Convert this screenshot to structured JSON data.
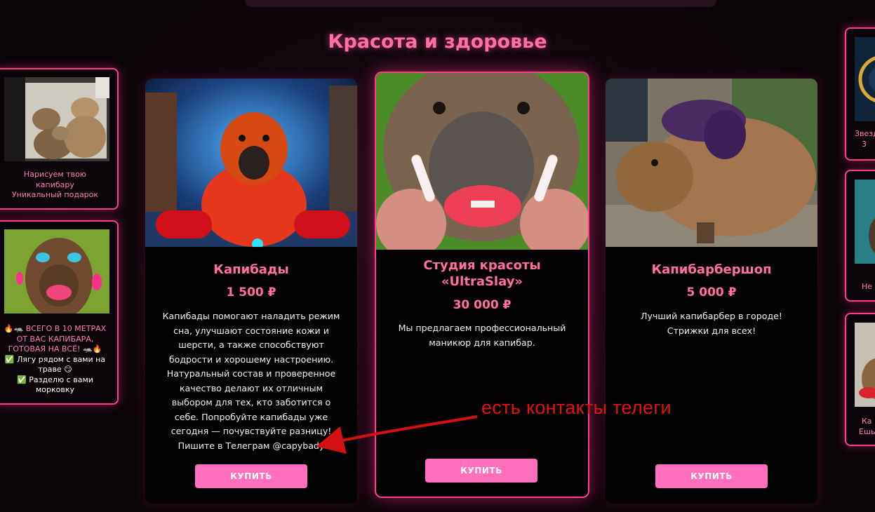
{
  "section": {
    "title": "Красота и здоровье"
  },
  "cards": [
    {
      "title": "Капибады",
      "price": "1 500 ₽",
      "description": "Капибады помогают наладить режим сна, улучшают состояние кожи и шерсти, а также способствуют бодрости и хорошему настроению. Натуральный состав и проверенное качество делают их отличным выбором для тех, кто заботится о себе. Попробуйте капибады уже сегодня — почувствуйте разницу! Пишите в Телеграм @capybady",
      "button": "КУПИТЬ"
    },
    {
      "title": "Студия красоты «UltraSlay»",
      "price": "30 000 ₽",
      "description": "Мы предлагаем профессиональный маникюр для капибар.",
      "button": "КУПИТЬ"
    },
    {
      "title": "Капибарбершоп",
      "price": "5 000 ₽",
      "description": "Лучший капибарбер в городе! Стрижки для всех!",
      "button": "КУПИТЬ"
    }
  ],
  "left_side": [
    {
      "lines": [
        "Нарисуем твою",
        "капибару",
        "Уникальный подарок"
      ]
    },
    {
      "lines": [
        "🔥🦡 ВСЕГО В 10 МЕТРАХ",
        "ОТ ВАС КАПИБАРА,",
        "ГОТОВАЯ НА ВСЁ! 🦡🔥",
        "✅ Лягу рядом с вами на",
        "траве 😏",
        "✅ Разделю с вами",
        "морковку"
      ]
    }
  ],
  "right_side": [
    {
      "lines": [
        "Звезд",
        "3"
      ]
    },
    {
      "lines": [
        "Не"
      ]
    },
    {
      "lines": [
        "Ка",
        "Ешь"
      ]
    }
  ],
  "annotation": {
    "text": "есть контакты телеги"
  },
  "colors": {
    "accent": "#ff6fa3",
    "button": "#ff6fbe",
    "border": "#ff3d8b",
    "annotation": "#e01414"
  }
}
